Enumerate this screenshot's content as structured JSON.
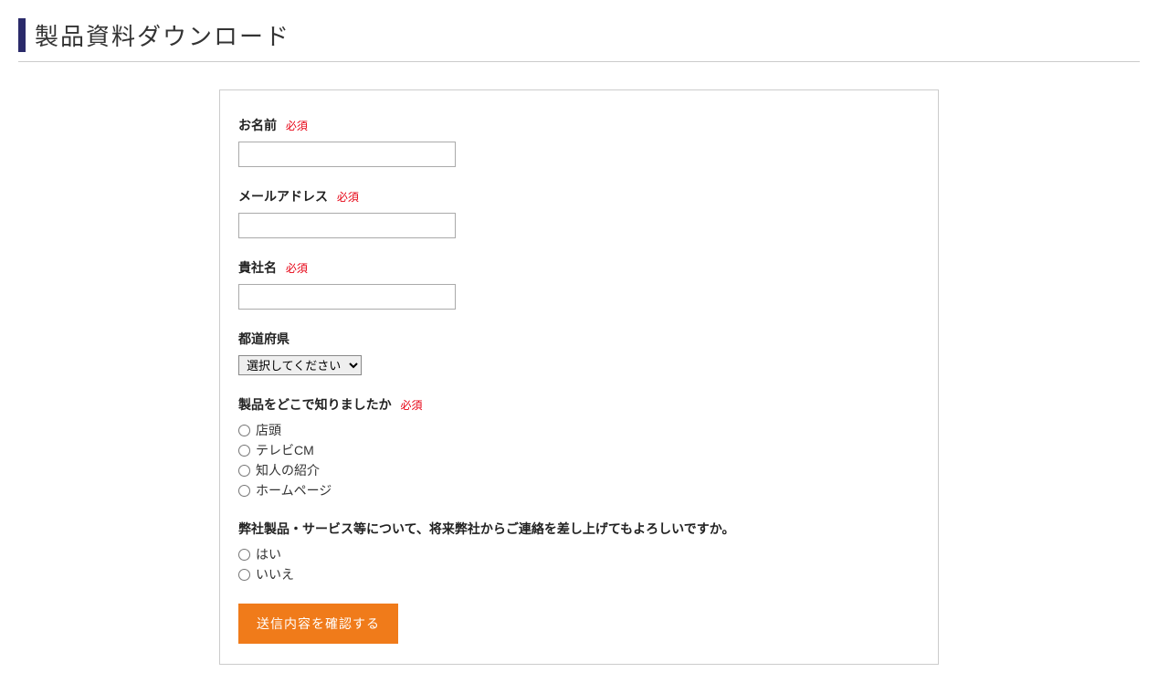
{
  "header": {
    "title": "製品資料ダウンロード"
  },
  "form": {
    "required_label": "必須",
    "fields": {
      "name": {
        "label": "お名前",
        "required": true
      },
      "email": {
        "label": "メールアドレス",
        "required": true
      },
      "company": {
        "label": "貴社名",
        "required": true
      },
      "prefecture": {
        "label": "都道府県",
        "required": false,
        "placeholder": "選択してください"
      },
      "source": {
        "label": "製品をどこで知りましたか",
        "required": true,
        "options": [
          "店頭",
          "テレビCM",
          "知人の紹介",
          "ホームページ"
        ]
      },
      "contact_permission": {
        "label": "弊社製品・サービス等について、将来弊社からご連絡を差し上げてもよろしいですか。",
        "required": false,
        "options": [
          "はい",
          "いいえ"
        ]
      }
    },
    "submit_label": "送信内容を確認する"
  }
}
